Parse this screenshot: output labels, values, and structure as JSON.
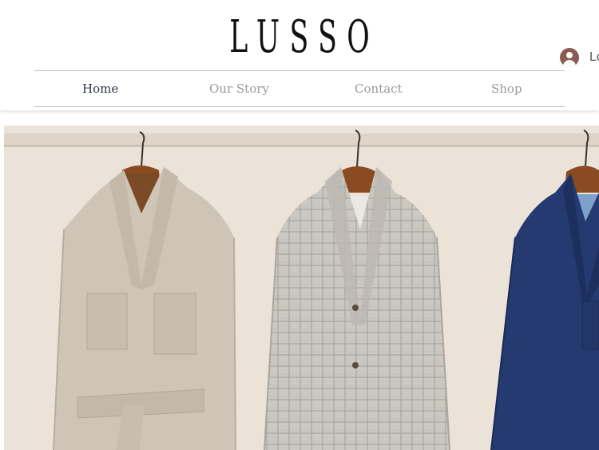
{
  "brand": {
    "logo_text": "LUSSO"
  },
  "account": {
    "login_label": "Log In",
    "icon": "user-avatar-icon"
  },
  "nav": {
    "items": [
      {
        "label": "Home",
        "active": true
      },
      {
        "label": "Our Story",
        "active": false
      },
      {
        "label": "Contact",
        "active": false
      },
      {
        "label": "Shop",
        "active": false
      }
    ]
  },
  "hero": {
    "subject": "three jackets on wooden hangers",
    "colors": {
      "background": "#ebe3d8",
      "rail": "#dcd2c4",
      "beige_jacket": "#cfc4b6",
      "check_jacket": "#c9c6c0",
      "navy_jacket": "#253a70",
      "hanger": "#8a4a22"
    }
  }
}
